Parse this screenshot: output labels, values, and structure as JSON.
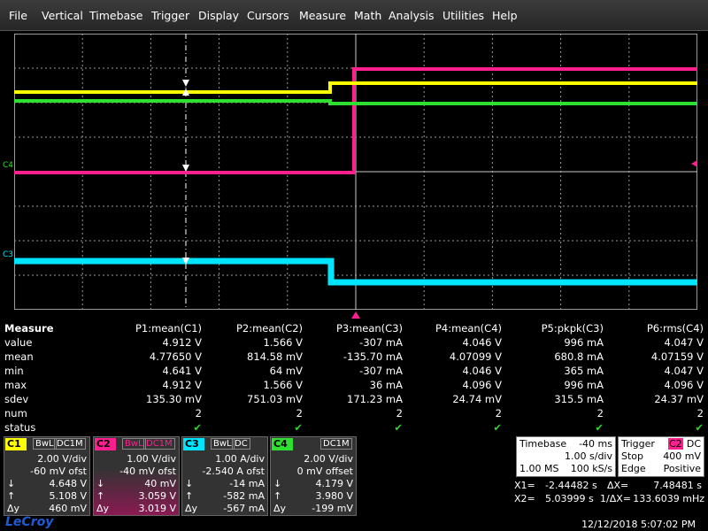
{
  "menu": [
    "File",
    "Vertical",
    "Timebase",
    "Trigger",
    "Display",
    "Cursors",
    "Measure",
    "Math",
    "Analysis",
    "Utilities",
    "Help"
  ],
  "markers": {
    "c4": "C4",
    "c3": "C3"
  },
  "colors": {
    "c1": "#ffff00",
    "c2": "#ff1f8f",
    "c3": "#00e5ff",
    "c4": "#30e030"
  },
  "measure": {
    "title": "Measure",
    "headers": [
      "P1:mean(C1)",
      "P2:mean(C2)",
      "P3:mean(C3)",
      "P4:mean(C4)",
      "P5:pkpk(C3)",
      "P6:rms(C4)"
    ],
    "rows": [
      {
        "label": "value",
        "cells": [
          "4.912 V",
          "1.566 V",
          "-307 mA",
          "4.046 V",
          "996 mA",
          "4.047 V"
        ]
      },
      {
        "label": "mean",
        "cells": [
          "4.77650 V",
          "814.58 mV",
          "-135.70 mA",
          "4.07099 V",
          "680.8 mA",
          "4.07159 V"
        ]
      },
      {
        "label": "min",
        "cells": [
          "4.641 V",
          "64 mV",
          "-307 mA",
          "4.046 V",
          "365 mA",
          "4.047 V"
        ]
      },
      {
        "label": "max",
        "cells": [
          "4.912 V",
          "1.566 V",
          "36 mA",
          "4.096 V",
          "996 mA",
          "4.096 V"
        ]
      },
      {
        "label": "sdev",
        "cells": [
          "135.30 mV",
          "751.03 mV",
          "171.23 mA",
          "24.74 mV",
          "315.5 mA",
          "24.37 mV"
        ]
      },
      {
        "label": "num",
        "cells": [
          "2",
          "2",
          "2",
          "2",
          "2",
          "2"
        ]
      }
    ],
    "status_label": "status",
    "status_mark": "✔"
  },
  "channels": [
    {
      "tag": "C1",
      "bw": "BwL",
      "dc": "DC1M",
      "scale": "2.00 V/div",
      "offset": "-60 mV ofst",
      "v1": "4.648 V",
      "v2": "5.108 V",
      "dv": "460 mV"
    },
    {
      "tag": "C2",
      "bw": "BwL",
      "dc": "DC1M",
      "scale": "1.00 V/div",
      "offset": "-40 mV ofst",
      "v1": "40 mV",
      "v2": "3.059 V",
      "dv": "3.019 V"
    },
    {
      "tag": "C3",
      "bw": "BwL",
      "dc": "DC",
      "scale": "1.00 A/div",
      "offset": "-2.540 A ofst",
      "v1": "-14 mA",
      "v2": "-582 mA",
      "dv": "-567 mA"
    },
    {
      "tag": "C4",
      "bw": "",
      "dc": "DC1M",
      "scale": "2.00 V/div",
      "offset": "0 mV offset",
      "v1": "4.179 V",
      "v2": "3.980 V",
      "dv": "-199 mV"
    }
  ],
  "cursor_symbols": {
    "a": "↓",
    "b": "↑",
    "d": "Δy"
  },
  "timebase": {
    "label": "Timebase",
    "delay": "-40 ms",
    "perdiv": "1.00 s/div",
    "ms": "1.00 MS",
    "rate": "100 kS/s"
  },
  "trigger": {
    "label": "Trigger",
    "src": "C2",
    "coupling": "DC",
    "mode": "Stop",
    "level": "400 mV",
    "type": "Edge",
    "slope": "Positive"
  },
  "cursors": {
    "x1": "X1=",
    "x1v": "-2.44482 s",
    "dx": "ΔX=",
    "dxv": "7.48481 s",
    "x2": "X2=",
    "x2v": "5.03999 s",
    "idx": "1/ΔX=",
    "idxv": "133.6039 mHz"
  },
  "logo": "LeCroy",
  "datetime": "12/12/2018 5:07:02 PM"
}
